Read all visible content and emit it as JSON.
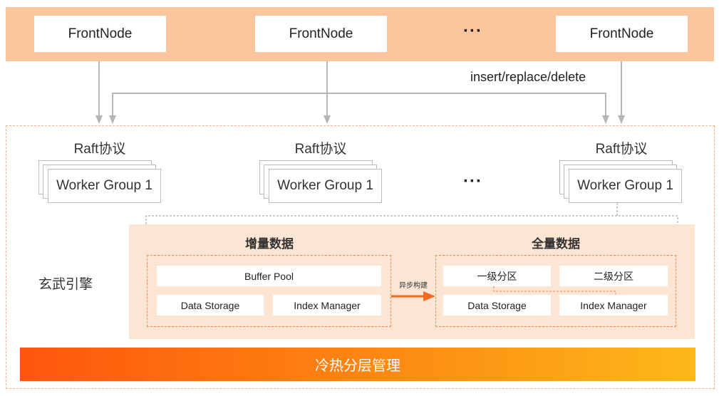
{
  "front_nodes": [
    "FrontNode",
    "FrontNode",
    "FrontNode"
  ],
  "ellipsis": "···",
  "write_ops_label": "insert/replace/delete",
  "raft_labels": [
    "Raft协议",
    "Raft协议",
    "Raft协议"
  ],
  "worker_groups": [
    "Worker Group 1",
    "Worker Group 1",
    "Worker Group 1"
  ],
  "engine_label": "玄武引擎",
  "incremental": {
    "title": "增量数据",
    "buffer_pool": "Buffer Pool",
    "data_storage": "Data Storage",
    "index_manager": "Index Manager"
  },
  "async_build_label": "异步构建",
  "full": {
    "title": "全量数据",
    "level1_partition": "一级分区",
    "level2_partition": "二级分区",
    "data_storage": "Data Storage",
    "index_manager": "Index Manager"
  },
  "tiering_bar": "冷热分层管理",
  "colors": {
    "top_band": "#fdc59e",
    "engine_bg": "#fde5d4",
    "accent": "#f26a1b",
    "gradient_start": "#ff560d",
    "gradient_end": "#fdb81a"
  }
}
